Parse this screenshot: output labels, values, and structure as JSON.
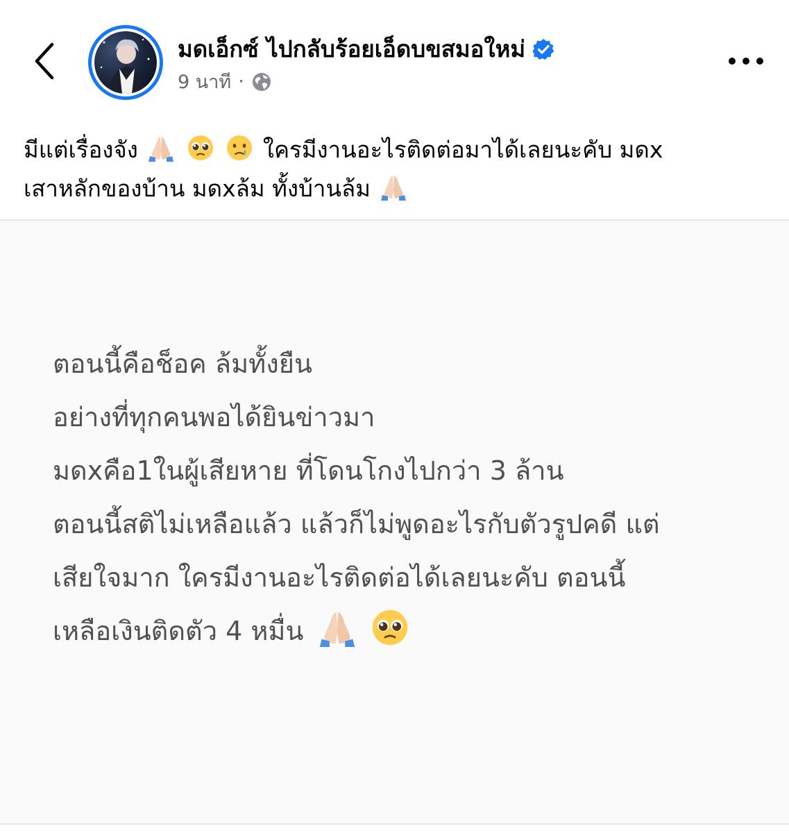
{
  "header": {
    "author_name": "มดเอ็กซ์ ไปกลับร้อยเอ็ดบขสมอใหม่",
    "timestamp": "9 นาที",
    "separator": "·",
    "verified": true,
    "privacy_icon": "globe-icon"
  },
  "post": {
    "caption_lines": [
      {
        "text_before": "มีแต่เรื่องจัง",
        "emojis": [
          "praying-hands",
          "pleading-face",
          "crying-face"
        ],
        "text_after": "ใครมีงานอะไรติดต่อมาได้เลยนะคับ มดx"
      },
      {
        "text_before": "เสาหลักของบ้าน มดxล้ม ทั้งบ้านล้ม",
        "emojis": [
          "praying-hands"
        ],
        "text_after": ""
      }
    ],
    "image_text_lines": [
      "ตอนนี้คือช็อค ล้มทั้งยืน",
      "อย่างที่ทุกคนพอได้ยินข่าวมา",
      "มดxคือ1ในผู้เสียหาย ที่โดนโกงไปกว่า 3 ล้าน",
      "ตอนนี้สติไม่เหลือแล้ว แล้วก็ไม่พูดอะไรกับตัวรูปคดี แต่",
      "เสียใจมาก ใครมีงานอะไรติดต่อได้เลยนะคับ ตอนนี้",
      "เหลือเงินติดตัว 4 หมื่น"
    ],
    "image_last_line_emojis": [
      "praying-hands",
      "pleading-face"
    ]
  },
  "colors": {
    "verified_blue": "#1877f2",
    "meta_gray": "#65676b",
    "card_text_gray": "#505050",
    "card_background": "#fafafa"
  }
}
